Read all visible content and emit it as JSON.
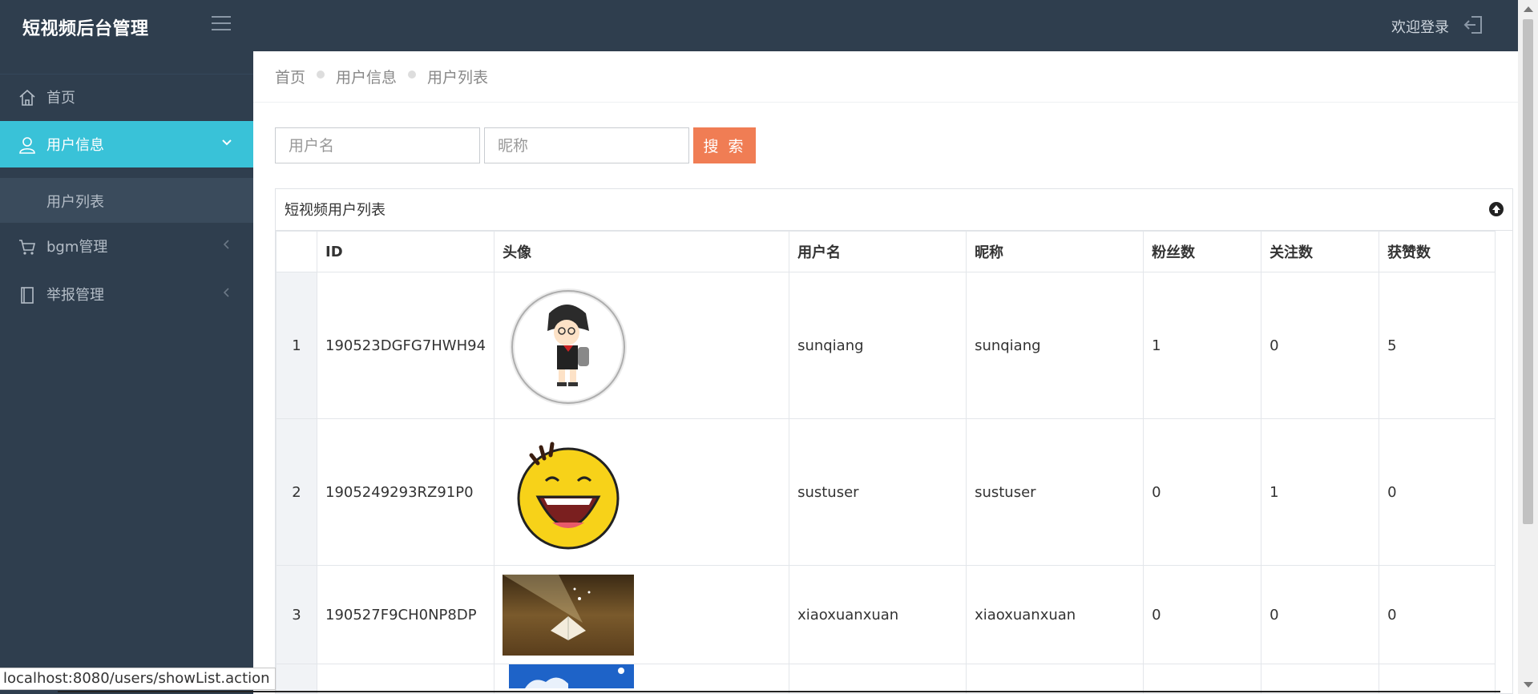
{
  "app": {
    "brand": "短视频后台管理",
    "welcome": "欢迎登录"
  },
  "sidebar": {
    "items": [
      {
        "label": "首页",
        "icon": "home-icon"
      },
      {
        "label": "用户信息",
        "icon": "user-icon",
        "active": true
      },
      {
        "label": "bgm管理",
        "icon": "cart-icon"
      },
      {
        "label": "举报管理",
        "icon": "book-icon"
      }
    ],
    "sub_items": [
      {
        "label": "用户列表"
      }
    ]
  },
  "breadcrumb": [
    "首页",
    "用户信息",
    "用户列表"
  ],
  "search": {
    "username_placeholder": "用户名",
    "nickname_placeholder": "昵称",
    "button_label": "搜 索"
  },
  "panel": {
    "title": "短视频用户列表"
  },
  "table": {
    "columns": [
      "",
      "ID",
      "头像",
      "用户名",
      "昵称",
      "粉丝数",
      "关注数",
      "获赞数"
    ],
    "rows": [
      {
        "num": "1",
        "id": "190523DGFG7HWH94",
        "username": "sunqiang",
        "nickname": "sunqiang",
        "fans": "1",
        "follows": "0",
        "likes": "5"
      },
      {
        "num": "2",
        "id": "1905249293RZ91P0",
        "username": "sustuser",
        "nickname": "sustuser",
        "fans": "0",
        "follows": "1",
        "likes": "0"
      },
      {
        "num": "3",
        "id": "190527F9CH0NP8DP",
        "username": "xiaoxuanxuan",
        "nickname": "xiaoxuanxuan",
        "fans": "0",
        "follows": "0",
        "likes": "0"
      }
    ]
  },
  "status_bar": {
    "url": "localhost:8080/users/showList.action"
  },
  "colors": {
    "sidebar_bg": "#2f3e4e",
    "active_accent": "#39c2d8",
    "search_button": "#f07d54"
  }
}
